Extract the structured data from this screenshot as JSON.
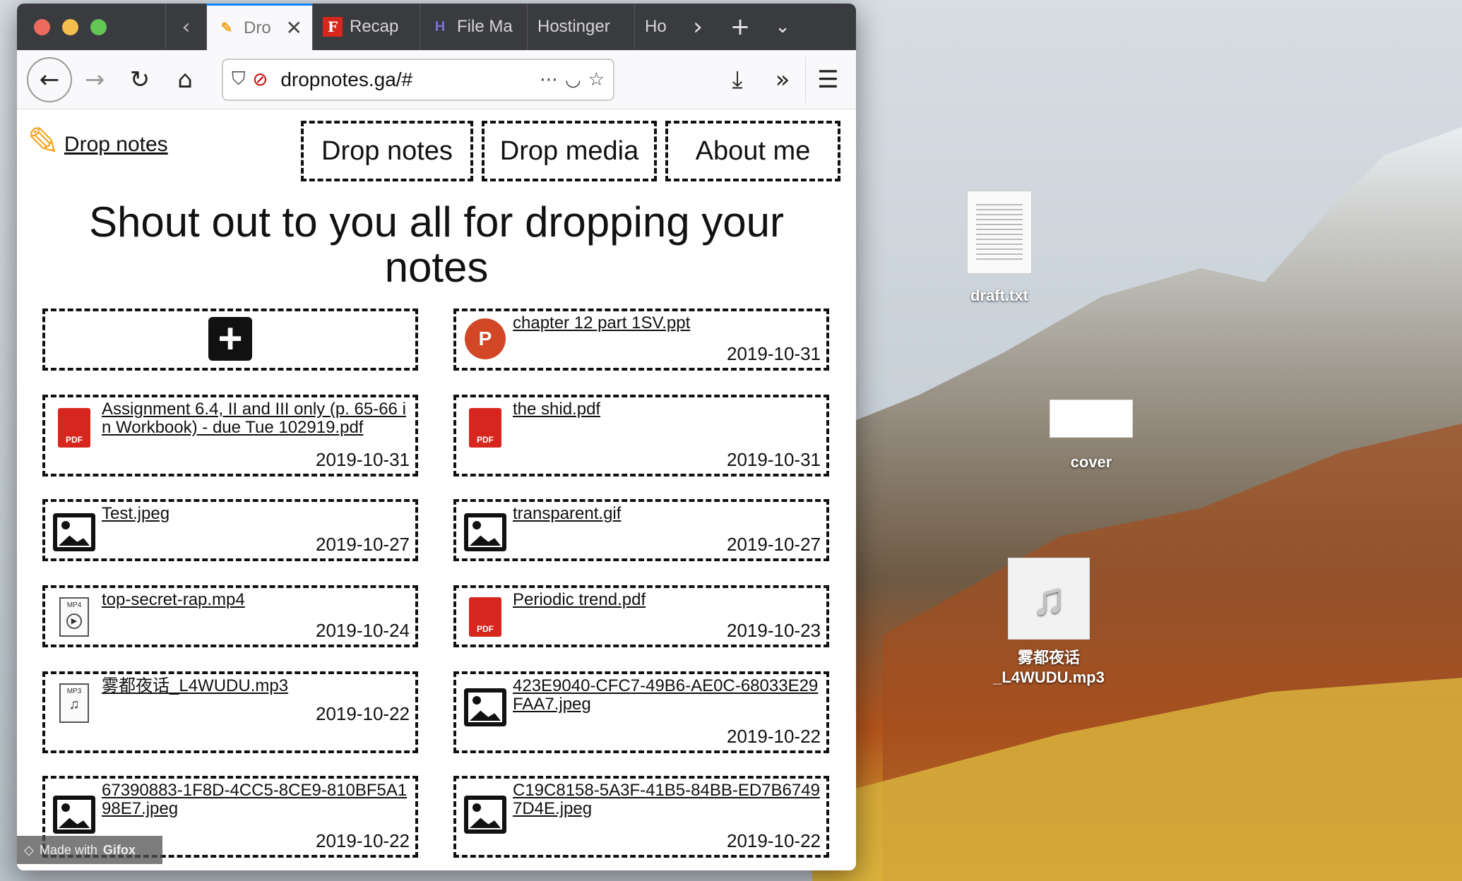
{
  "browser": {
    "tabs": [
      {
        "label": "Dro",
        "icon": "pencil-icon",
        "active": true
      },
      {
        "label": "Recap",
        "icon": "f-logo-icon",
        "active": false
      },
      {
        "label": "File Ma",
        "icon": "hostinger-icon",
        "active": false
      },
      {
        "label": "Hostinger",
        "icon": "",
        "active": false
      },
      {
        "label": "Ho",
        "icon": "",
        "active": false
      }
    ],
    "url": "dropnotes.ga/#",
    "close_glyph": "✕"
  },
  "site": {
    "brand": "Drop notes",
    "nav": [
      {
        "label": "Drop notes"
      },
      {
        "label": "Drop media"
      },
      {
        "label": "About me"
      }
    ],
    "headline_line1": "Shout out to you all for dropping your",
    "headline_line2": "notes"
  },
  "files": [
    {
      "name": "",
      "date": "",
      "type": "add"
    },
    {
      "name": "chapter 12 part 1SV.ppt",
      "date": "2019-10-31",
      "type": "ppt"
    },
    {
      "name": "Assignment 6.4, II and III only (p. 65-66 in Workbook) - due Tue 102919.pdf",
      "date": "2019-10-31",
      "type": "pdf"
    },
    {
      "name": "the shid.pdf",
      "date": "2019-10-31",
      "type": "pdf"
    },
    {
      "name": "Test.jpeg",
      "date": "2019-10-27",
      "type": "image"
    },
    {
      "name": "transparent.gif",
      "date": "2019-10-27",
      "type": "image"
    },
    {
      "name": "top-secret-rap.mp4",
      "date": "2019-10-24",
      "type": "mp4"
    },
    {
      "name": "Periodic trend.pdf",
      "date": "2019-10-23",
      "type": "pdf"
    },
    {
      "name": "雾都夜话_L4WUDU.mp3",
      "date": "2019-10-22",
      "type": "mp3"
    },
    {
      "name": "423E9040-CFC7-49B6-AE0C-68033E29FAA7.jpeg",
      "date": "2019-10-22",
      "type": "image"
    },
    {
      "name": "67390883-1F8D-4CC5-8CE9-810BF5A198E7.jpeg",
      "date": "2019-10-22",
      "type": "image"
    },
    {
      "name": "C19C8158-5A3F-41B5-84BB-ED7B67497D4E.jpeg",
      "date": "2019-10-22",
      "type": "image"
    }
  ],
  "desktop": {
    "items": [
      {
        "label": "draft.txt",
        "icon": "text-file-icon"
      },
      {
        "label": "cover",
        "icon": "image-thumbnail-icon"
      },
      {
        "label": "雾都夜话\n_L4WUDU.mp3",
        "icon": "music-file-icon"
      }
    ]
  },
  "watermark": {
    "prefix": "Made with",
    "brand": "Gifox"
  },
  "colors": {
    "tab_accent": "#0a84ff",
    "tabbar_bg": "#3a3b3f",
    "pdf_red": "#d7261e",
    "ppt_orange": "#d24726"
  }
}
